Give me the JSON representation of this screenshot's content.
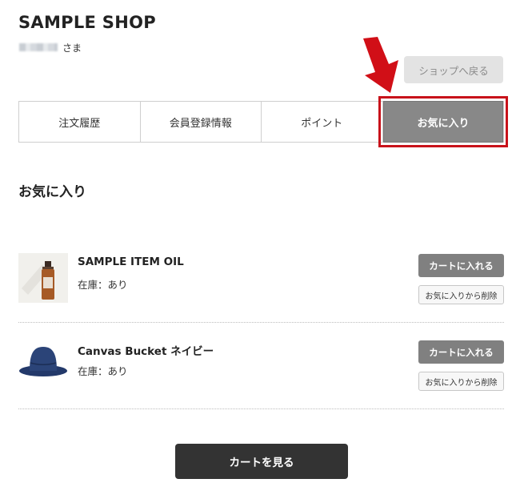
{
  "shop": {
    "title": "SAMPLE SHOP"
  },
  "user": {
    "honorific": "さま"
  },
  "header": {
    "back_label": "ショップへ戻る"
  },
  "tabs": [
    {
      "label": "注文履歴"
    },
    {
      "label": "会員登録情報"
    },
    {
      "label": "ポイント"
    },
    {
      "label": "お気に入り",
      "active": true
    }
  ],
  "section": {
    "title": "お気に入り"
  },
  "favorites": [
    {
      "name": "SAMPLE ITEM OIL",
      "stock": "在庫：あり",
      "cart_label": "カートに入れる",
      "remove_label": "お気に入りから削除",
      "image": "oil-bottle-icon"
    },
    {
      "name": "Canvas Bucket ネイビー",
      "stock": "在庫：あり",
      "cart_label": "カートに入れる",
      "remove_label": "お気に入りから削除",
      "image": "bucket-hat-icon"
    }
  ],
  "footer": {
    "view_cart_label": "カートを見る"
  },
  "colors": {
    "highlight": "#c8121a",
    "active_tab": "#888888",
    "cart_button": "#808080",
    "view_cart_button": "#333333"
  }
}
